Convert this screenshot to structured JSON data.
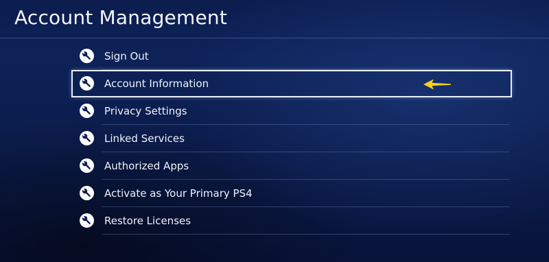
{
  "header": {
    "title": "Account Management"
  },
  "menu": {
    "items": [
      {
        "label": "Sign Out",
        "icon": "wrench-icon"
      },
      {
        "label": "Account Information",
        "icon": "wrench-icon",
        "selected": true
      },
      {
        "label": "Privacy Settings",
        "icon": "wrench-icon"
      },
      {
        "label": "Linked Services",
        "icon": "wrench-icon"
      },
      {
        "label": "Authorized Apps",
        "icon": "wrench-icon"
      },
      {
        "label": "Activate as Your Primary PS4",
        "icon": "wrench-icon"
      },
      {
        "label": "Restore Licenses",
        "icon": "wrench-icon"
      }
    ]
  },
  "annotation": {
    "icon": "left-arrow-pointer-icon",
    "color": "#f5d21c"
  },
  "colors": {
    "background": "#0c1d4e",
    "text": "#eef2fa",
    "selection_border": "#e9eef8"
  }
}
